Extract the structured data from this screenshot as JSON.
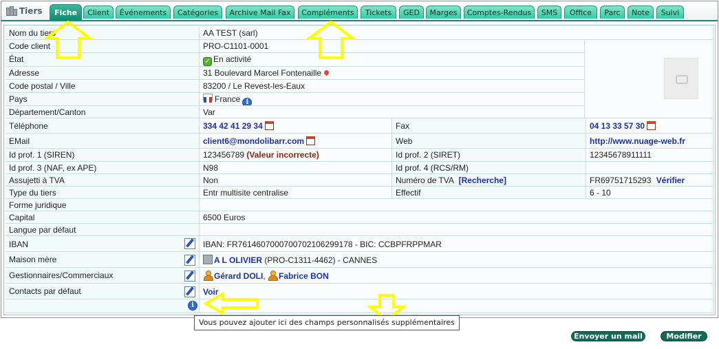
{
  "header": {
    "title": "Tiers",
    "tabs": [
      "Fiche",
      "Client",
      "Événements",
      "Catégories",
      "Archive Mail Fax",
      "Compléments",
      "Tickets",
      "GED",
      "Marges",
      "Comptes-Rendus",
      "SMS",
      "Office",
      "Parc",
      "Note",
      "Suivi"
    ],
    "active_tab": "Fiche"
  },
  "fields": {
    "nom_label": "Nom du tiers",
    "nom_value": "AA TEST (sarl)",
    "code_label": "Code client",
    "code_value": "PRO-C1101-0001",
    "etat_label": "État",
    "etat_value": "En activité",
    "adresse_label": "Adresse",
    "adresse_value": "31 Boulevard Marcel Fontenaille",
    "cp_label": "Code postal / Ville",
    "cp_value": "83200 / Le Revest-les-Eaux",
    "pays_label": "Pays",
    "pays_value": "France",
    "dept_label": "Département/Canton",
    "dept_value": "Var",
    "tel_label": "Téléphone",
    "tel_value": "334 42 41 29 34",
    "fax_label": "Fax",
    "fax_value": "04 13 33 57 30",
    "email_label": "EMail",
    "email_value": "client6@mondolibarr.com",
    "web_label": "Web",
    "web_value": "http://www.nuage-web.fr",
    "siren_label": "Id prof. 1 (SIREN)",
    "siren_value": "123456789",
    "siren_warn": "(Valeur incorrecte)",
    "siret_label": "Id prof. 2 (SIRET)",
    "siret_value": "12345678911111",
    "naf_label": "Id prof. 3 (NAF, ex APE)",
    "naf_value": "N98",
    "rcs_label": "Id prof. 4 (RCS/RM)",
    "rcs_value": "",
    "tva_label": "Assujetti à TVA",
    "tva_value": "Non",
    "numtva_label": "Numéro de TVA",
    "numtva_search": "[Recherche]",
    "numtva_value": "FR69751715293",
    "numtva_verify": "Vérifier",
    "type_label": "Type du tiers",
    "type_value": "Entr multisite centralise",
    "effectif_label": "Effectif",
    "effectif_value": "6 - 10",
    "forme_label": "Forme juridique",
    "forme_value": "",
    "capital_label": "Capital",
    "capital_value": "6500 Euros",
    "langue_label": "Langue par défaut",
    "langue_value": "",
    "iban_label": "IBAN",
    "iban_value": "IBAN: FR7614607000700702106299178 - BIC: CCBPFRPPMAR",
    "maison_label": "Maison mère",
    "maison_link": "A L OLIVIER",
    "maison_rest": "(PRO-C1311-4462) - CANNES",
    "gest_label": "Gestionnaires/Commerciaux",
    "gest_1": "Gérard DOLI",
    "gest_sep": ",",
    "gest_2": "Fabrice BON",
    "contacts_label": "Contacts par défaut",
    "contacts_link": "Voir"
  },
  "tooltip": "Vous pouvez ajouter ici des champs personnalisés supplémentaires",
  "buttons": {
    "send_mail": "Envoyer un mail",
    "modify": "Modifier"
  },
  "colors": {
    "tab_active": "#118a72",
    "tab": "#3ac9a3",
    "link": "#1c2fb0",
    "annotation_arrow": "#ffff00",
    "button": "#126957"
  },
  "icons": [
    "building-icon",
    "check-icon",
    "map-pin-icon",
    "france-flag-icon",
    "info-icon",
    "calendar-icon",
    "edit-icon",
    "user-icon",
    "photo-placeholder-icon"
  ]
}
